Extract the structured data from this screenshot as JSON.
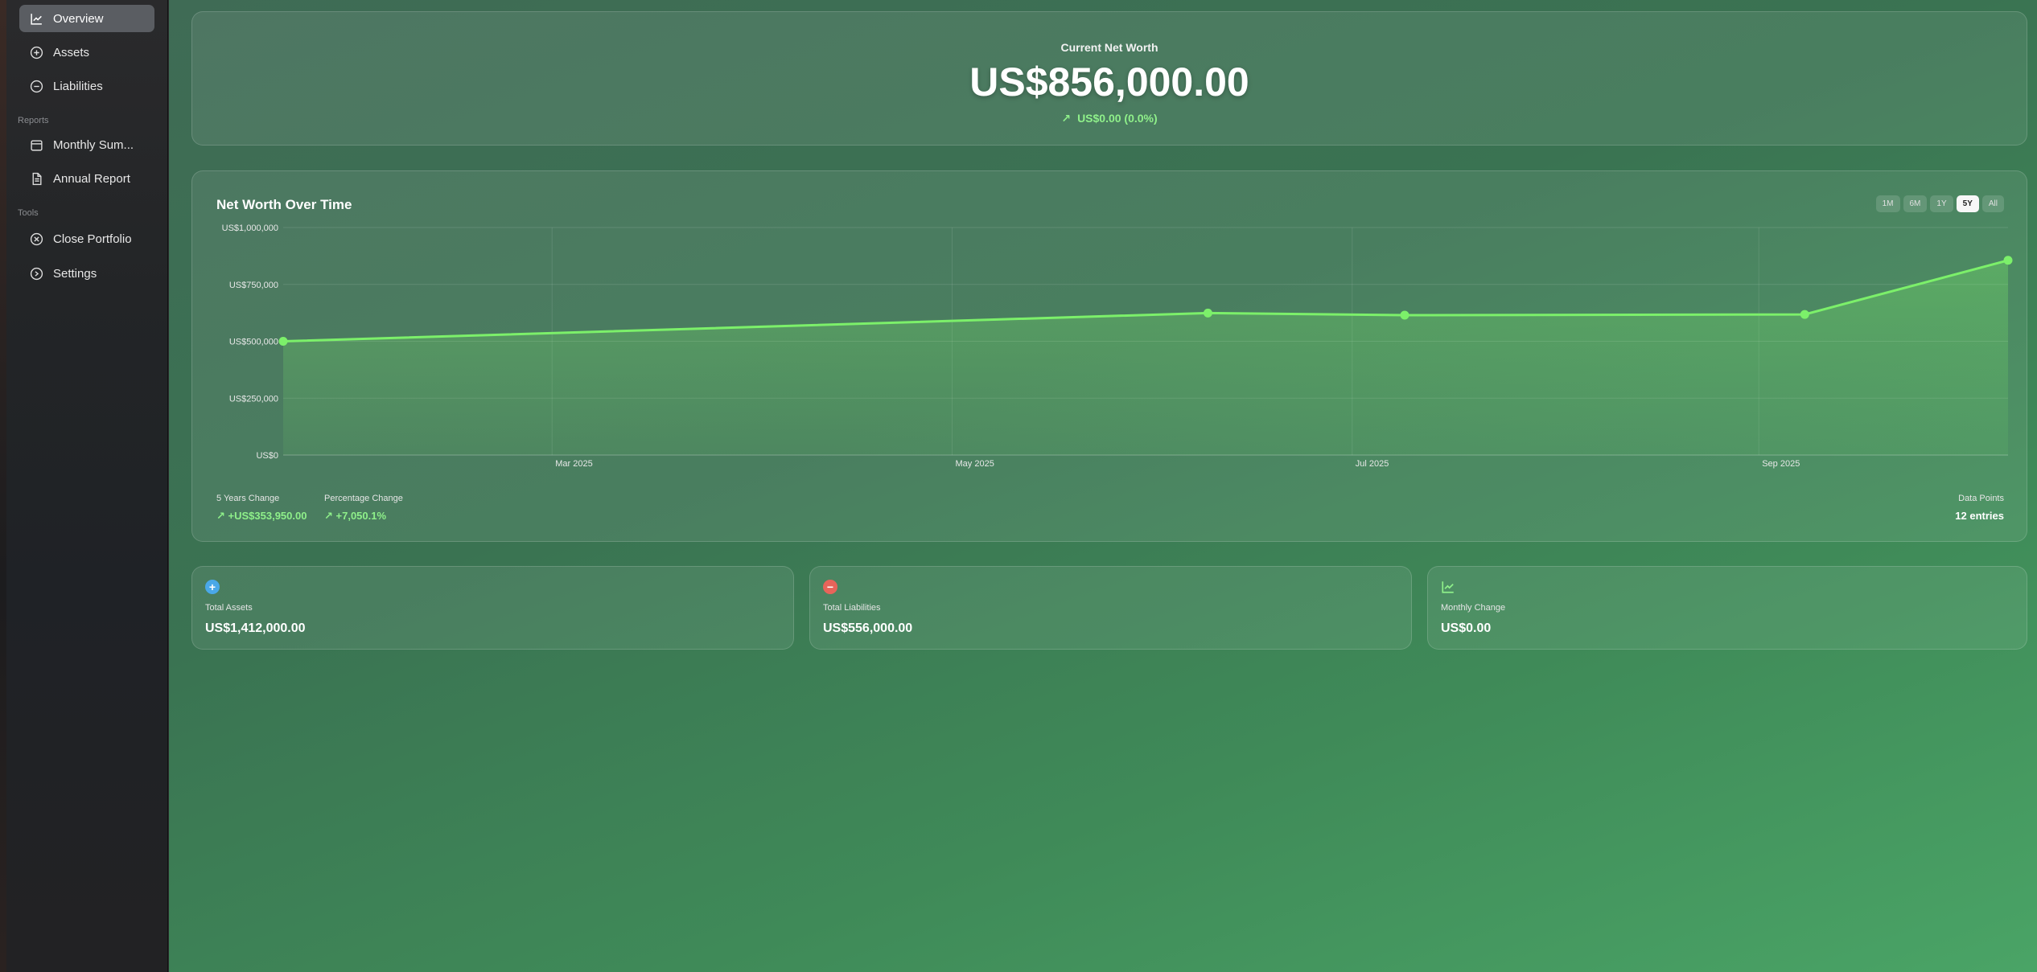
{
  "sidebar": {
    "items": [
      {
        "label": "Overview",
        "icon": "chart-line-icon"
      },
      {
        "label": "Assets",
        "icon": "plus-circle-icon"
      },
      {
        "label": "Liabilities",
        "icon": "minus-circle-icon"
      }
    ],
    "reports_label": "Reports",
    "reports": [
      {
        "label": "Monthly Sum...",
        "icon": "calendar-icon"
      },
      {
        "label": "Annual Report",
        "icon": "document-icon"
      }
    ],
    "tools_label": "Tools",
    "tools": [
      {
        "label": "Close Portfolio",
        "icon": "x-circle-icon"
      },
      {
        "label": "Settings",
        "icon": "gear-icon"
      }
    ]
  },
  "net_worth": {
    "label": "Current Net Worth",
    "value": "US$856,000.00",
    "change": "US$0.00 (0.0%)"
  },
  "chart": {
    "title": "Net Worth Over Time",
    "ranges": [
      "1M",
      "6M",
      "1Y",
      "5Y",
      "All"
    ],
    "active_range": "5Y",
    "stats": {
      "change_label": "5 Years Change",
      "change_value": "+US$353,950.00",
      "pct_label": "Percentage Change",
      "pct_value": "+7,050.1%",
      "points_label": "Data Points",
      "points_value": "12 entries"
    }
  },
  "chart_data": {
    "type": "area",
    "title": "Net Worth Over Time",
    "x": [
      "2025-01-19",
      "2025-06-09",
      "2025-07-09",
      "2025-09-08",
      "2025-10-09"
    ],
    "values": [
      500000,
      624000,
      615000,
      618000,
      856000
    ],
    "x_tick_labels": [
      "Mar 2025",
      "May 2025",
      "Jul 2025",
      "Sep 2025"
    ],
    "x_tick_dates": [
      "2025-03-01",
      "2025-05-01",
      "2025-07-01",
      "2025-09-01"
    ],
    "y_tick_labels": [
      "US$1,000,000",
      "US$750,000",
      "US$500,000",
      "US$250,000",
      "US$0"
    ],
    "y_ticks": [
      1000000,
      750000,
      500000,
      250000,
      0
    ],
    "ylim": [
      0,
      1000000
    ],
    "xlim": [
      "2025-01-19",
      "2025-10-09"
    ],
    "grid": true,
    "line_color": "#7cf06a"
  },
  "summary": [
    {
      "label": "Total Assets",
      "value": "US$1,412,000.00",
      "icon": "plus-icon",
      "color": "#4aa8e8"
    },
    {
      "label": "Total Liabilities",
      "value": "US$556,000.00",
      "icon": "minus-icon",
      "color": "#e8645a"
    },
    {
      "label": "Monthly Change",
      "value": "US$0.00",
      "icon": "chart-line-icon",
      "color": "#8ff08a"
    }
  ]
}
